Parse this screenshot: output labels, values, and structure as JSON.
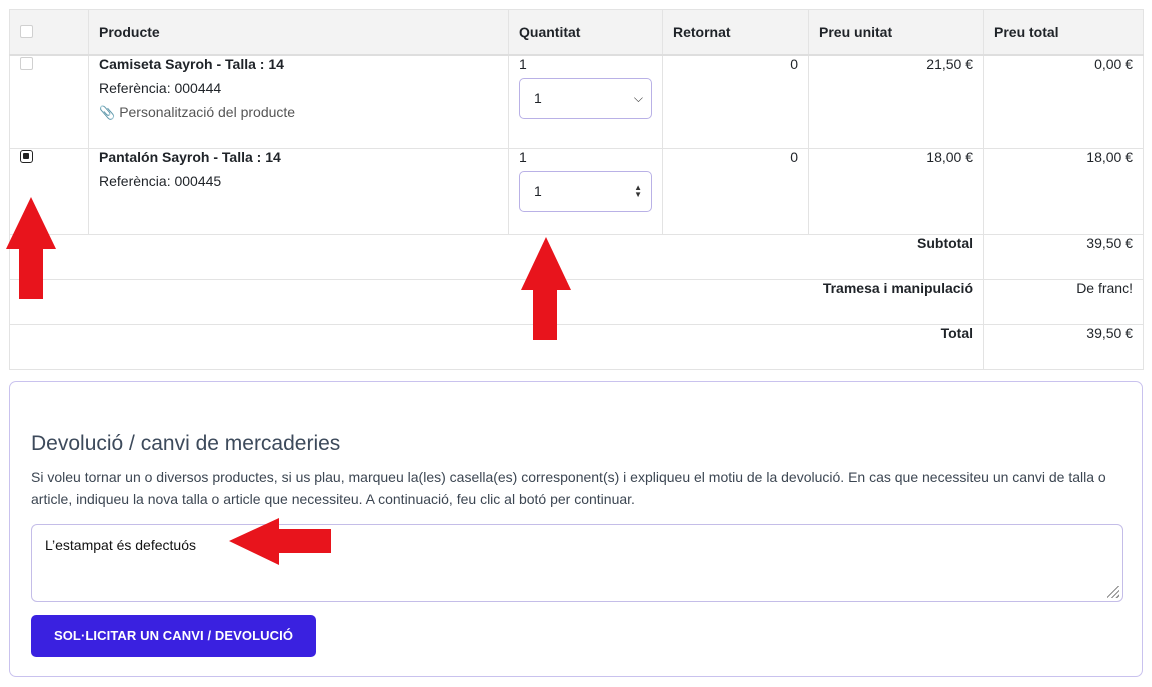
{
  "table": {
    "headers": [
      "",
      "Producte",
      "Quantitat",
      "Retornat",
      "Preu unitat",
      "Preu total"
    ],
    "rows": [
      {
        "name": "Camiseta Sayroh - Talla : 14",
        "reference": "Referència: 000444",
        "customization": "Personalització del producte",
        "quantity": "1",
        "select_value": "1",
        "returned": "0",
        "unit_price": "21,50 €",
        "total_price": "0,00 €",
        "checked": false
      },
      {
        "name": "Pantalón Sayroh - Talla : 14",
        "reference": "Referència: 000445",
        "quantity": "1",
        "select_value": "1",
        "returned": "0",
        "unit_price": "18,00 €",
        "total_price": "18,00 €",
        "checked": true
      }
    ],
    "summary": [
      {
        "label": "Subtotal",
        "value": "39,50 €"
      },
      {
        "label": "Tramesa i manipulació",
        "value": "De franc!"
      },
      {
        "label": "Total",
        "value": "39,50 €"
      }
    ]
  },
  "return_panel": {
    "title": "Devolució / canvi de mercaderies",
    "description": "Si voleu tornar un o diversos productes, si us plau, marqueu la(les) casella(es) corresponent(s) i expliqueu el motiu de la devolució. En cas que necessiteu un canvi de talla o article, indiqueu la nova talla o article que necessiteu. A continuació, feu clic al botó per continuar.",
    "textarea_value": "L’estampat és defectuós",
    "button_label": "SOL·LICITAR UN CANVI / DEVOLUCIÓ"
  },
  "colors": {
    "accent": "#3a21e0",
    "annotation_arrow": "#e8141c"
  },
  "icons": [
    "paperclip-icon",
    "chevron-down-icon",
    "spinner-arrows-icon",
    "resize-grip-icon",
    "arrow-up-icon",
    "arrow-left-icon"
  ]
}
